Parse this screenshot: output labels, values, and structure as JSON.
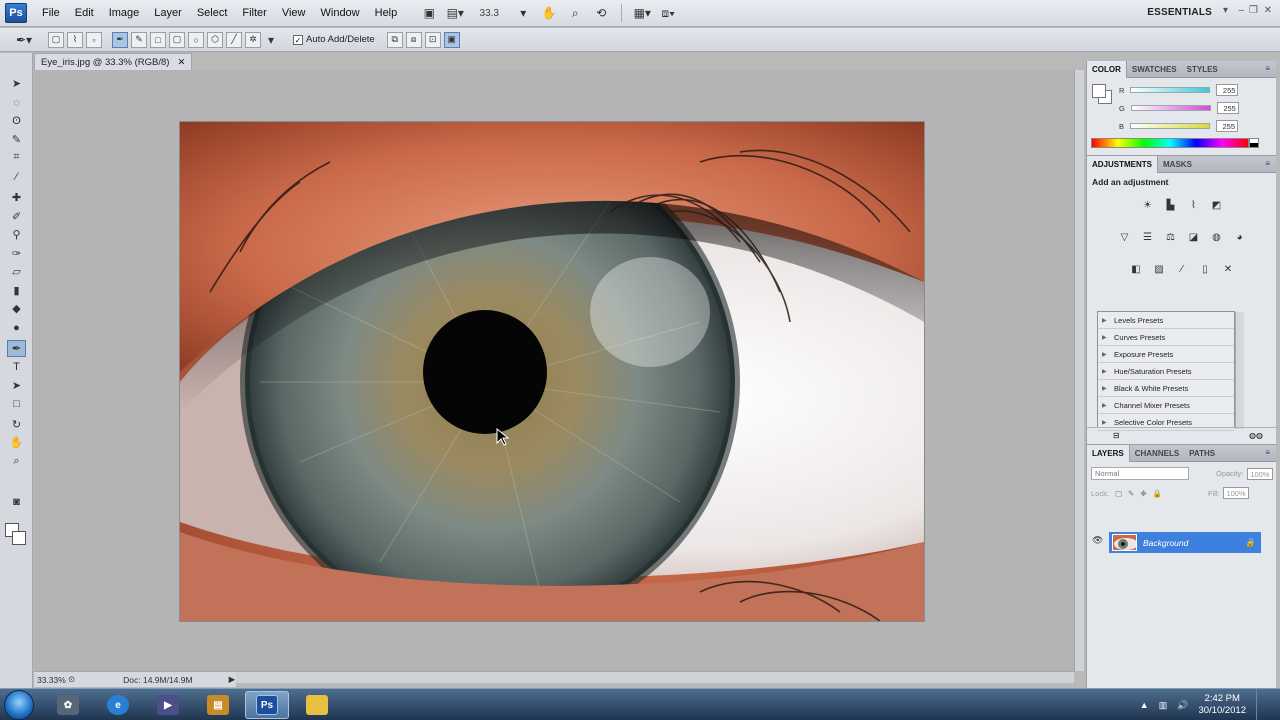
{
  "app": {
    "logo": "Ps",
    "menus": [
      "File",
      "Edit",
      "Image",
      "Layer",
      "Select",
      "Filter",
      "View",
      "Window",
      "Help"
    ],
    "zoom_display": "33.3",
    "workspace": "ESSENTIALS"
  },
  "options_bar": {
    "auto_add_delete_label": "Auto Add/Delete",
    "auto_add_delete_checked": true
  },
  "document": {
    "tab_title": "Eye_iris.jpg @ 33.3% (RGB/8)",
    "status_zoom": "33.33%",
    "status_doc": "Doc: 14.9M/14.9M"
  },
  "color_panel": {
    "tabs": [
      "COLOR",
      "SWATCHES",
      "STYLES"
    ],
    "channels": [
      {
        "label": "R",
        "value": "255",
        "color": "#3cc8d8"
      },
      {
        "label": "G",
        "value": "255",
        "color": "#d64ad8"
      },
      {
        "label": "B",
        "value": "255",
        "color": "#d8d83a"
      }
    ]
  },
  "adjustments_panel": {
    "tabs": [
      "ADJUSTMENTS",
      "MASKS"
    ],
    "title": "Add an adjustment",
    "presets": [
      "Levels Presets",
      "Curves Presets",
      "Exposure Presets",
      "Hue/Saturation Presets",
      "Black & White Presets",
      "Channel Mixer Presets",
      "Selective Color Presets"
    ]
  },
  "layers_panel": {
    "tabs": [
      "LAYERS",
      "CHANNELS",
      "PATHS"
    ],
    "blend_mode": "Normal",
    "opacity_label": "Opacity:",
    "opacity_value": "100%",
    "lock_label": "Lock:",
    "fill_label": "Fill:",
    "fill_value": "100%",
    "layers": [
      {
        "name": "Background",
        "visible": true,
        "locked": true,
        "selected": true
      }
    ]
  },
  "taskbar": {
    "time": "2:42 PM",
    "date": "30/10/2012",
    "apps": [
      "start-orb",
      "sync-app",
      "internet-explorer",
      "media-player",
      "file-manager",
      "photoshop",
      "windows-explorer"
    ],
    "active_app": "photoshop"
  },
  "colors": {
    "layer_selected": "#3d80de",
    "photoshop_blue": "#1d4f9a"
  }
}
